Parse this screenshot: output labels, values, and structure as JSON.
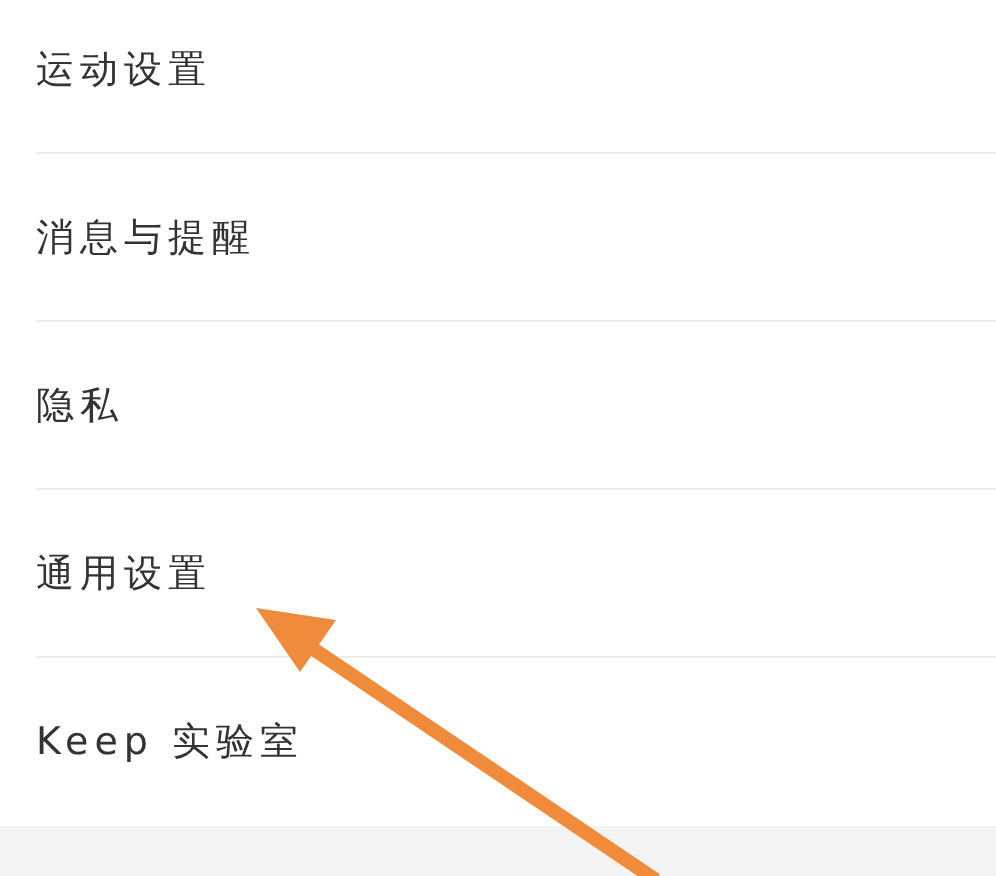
{
  "settings_list": [
    {
      "label": "运动设置"
    },
    {
      "label": "消息与提醒"
    },
    {
      "label": "隐私"
    },
    {
      "label": "通用设置"
    },
    {
      "label": "Keep 实验室"
    }
  ]
}
